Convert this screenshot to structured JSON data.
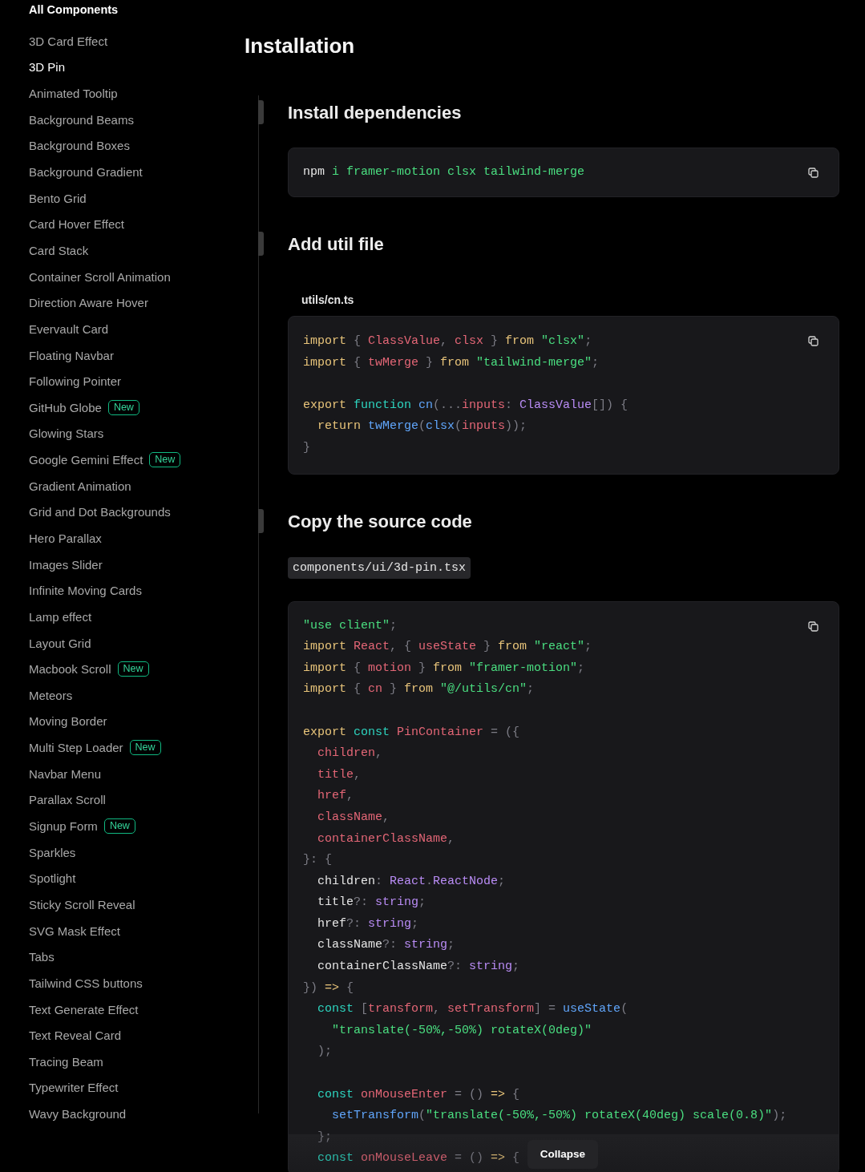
{
  "sidebar": {
    "heading": "All Components",
    "items": [
      {
        "label": "3D Card Effect",
        "selected": false
      },
      {
        "label": "3D Pin",
        "selected": true
      },
      {
        "label": "Animated Tooltip",
        "selected": false
      },
      {
        "label": "Background Beams",
        "selected": false
      },
      {
        "label": "Background Boxes",
        "selected": false
      },
      {
        "label": "Background Gradient",
        "selected": false
      },
      {
        "label": "Bento Grid",
        "selected": false
      },
      {
        "label": "Card Hover Effect",
        "selected": false
      },
      {
        "label": "Card Stack",
        "selected": false
      },
      {
        "label": "Container Scroll Animation",
        "selected": false
      },
      {
        "label": "Direction Aware Hover",
        "selected": false
      },
      {
        "label": "Evervault Card",
        "selected": false
      },
      {
        "label": "Floating Navbar",
        "selected": false
      },
      {
        "label": "Following Pointer",
        "selected": false
      },
      {
        "label": "GitHub Globe",
        "selected": false,
        "badge": "New"
      },
      {
        "label": "Glowing Stars",
        "selected": false
      },
      {
        "label": "Google Gemini Effect",
        "selected": false,
        "badge": "New"
      },
      {
        "label": "Gradient Animation",
        "selected": false
      },
      {
        "label": "Grid and Dot Backgrounds",
        "selected": false
      },
      {
        "label": "Hero Parallax",
        "selected": false
      },
      {
        "label": "Images Slider",
        "selected": false
      },
      {
        "label": "Infinite Moving Cards",
        "selected": false
      },
      {
        "label": "Lamp effect",
        "selected": false
      },
      {
        "label": "Layout Grid",
        "selected": false
      },
      {
        "label": "Macbook Scroll",
        "selected": false,
        "badge": "New"
      },
      {
        "label": "Meteors",
        "selected": false
      },
      {
        "label": "Moving Border",
        "selected": false
      },
      {
        "label": "Multi Step Loader",
        "selected": false,
        "badge": "New"
      },
      {
        "label": "Navbar Menu",
        "selected": false
      },
      {
        "label": "Parallax Scroll",
        "selected": false
      },
      {
        "label": "Signup Form",
        "selected": false,
        "badge": "New"
      },
      {
        "label": "Sparkles",
        "selected": false
      },
      {
        "label": "Spotlight",
        "selected": false
      },
      {
        "label": "Sticky Scroll Reveal",
        "selected": false
      },
      {
        "label": "SVG Mask Effect",
        "selected": false
      },
      {
        "label": "Tabs",
        "selected": false
      },
      {
        "label": "Tailwind CSS buttons",
        "selected": false
      },
      {
        "label": "Text Generate Effect",
        "selected": false
      },
      {
        "label": "Text Reveal Card",
        "selected": false
      },
      {
        "label": "Tracing Beam",
        "selected": false
      },
      {
        "label": "Typewriter Effect",
        "selected": false
      },
      {
        "label": "Wavy Background",
        "selected": false
      }
    ]
  },
  "title": "Installation",
  "steps": [
    {
      "kind": "command",
      "title": "Install dependencies",
      "lines": [
        {
          "tokens": [
            {
              "kind": "plain",
              "text": "npm"
            },
            {
              "kind": "string",
              "text": " i framer-motion clsx tailwind-merge"
            }
          ]
        }
      ]
    },
    {
      "kind": "file",
      "title": "Add util file",
      "filename": "utils/cn.ts",
      "lines": [
        {
          "tokens": [
            {
              "kind": "keyword",
              "text": "import"
            },
            {
              "kind": "punct",
              "text": " { "
            },
            {
              "kind": "variable",
              "text": "ClassValue"
            },
            {
              "kind": "punct",
              "text": ", "
            },
            {
              "kind": "variable",
              "text": "clsx"
            },
            {
              "kind": "punct",
              "text": " } "
            },
            {
              "kind": "keyword",
              "text": "from"
            },
            {
              "kind": "string",
              "text": " \"clsx\""
            },
            {
              "kind": "punct",
              "text": ";"
            }
          ]
        },
        {
          "tokens": [
            {
              "kind": "keyword",
              "text": "import"
            },
            {
              "kind": "punct",
              "text": " { "
            },
            {
              "kind": "variable",
              "text": "twMerge"
            },
            {
              "kind": "punct",
              "text": " } "
            },
            {
              "kind": "keyword",
              "text": "from"
            },
            {
              "kind": "string",
              "text": " \"tailwind-merge\""
            },
            {
              "kind": "punct",
              "text": ";"
            }
          ]
        },
        {
          "space_before": true,
          "tokens": [
            {
              "kind": "keyword",
              "text": "export"
            },
            {
              "kind": "decl",
              "text": " function"
            },
            {
              "kind": "call",
              "text": " cn"
            },
            {
              "kind": "punct",
              "text": "(..."
            },
            {
              "kind": "variable",
              "text": "inputs"
            },
            {
              "kind": "punct",
              "text": ": "
            },
            {
              "kind": "type",
              "text": "ClassValue"
            },
            {
              "kind": "punct",
              "text": "[]) {"
            }
          ]
        },
        {
          "tokens": [
            {
              "kind": "keyword",
              "text": "  return"
            },
            {
              "kind": "call",
              "text": " twMerge"
            },
            {
              "kind": "punct",
              "text": "("
            },
            {
              "kind": "call",
              "text": "clsx"
            },
            {
              "kind": "punct",
              "text": "("
            },
            {
              "kind": "variable",
              "text": "inputs"
            },
            {
              "kind": "punct",
              "text": "));"
            }
          ]
        },
        {
          "tokens": [
            {
              "kind": "punct",
              "text": "}"
            }
          ]
        }
      ]
    },
    {
      "kind": "source",
      "title": "Copy the source code",
      "filename": "components/ui/3d-pin.tsx",
      "collapse": "Collapse",
      "lines": [
        {
          "tokens": [
            {
              "kind": "string",
              "text": "\"use client\""
            },
            {
              "kind": "punct",
              "text": ";"
            }
          ]
        },
        {
          "tokens": [
            {
              "kind": "keyword",
              "text": "import"
            },
            {
              "kind": "variable",
              "text": " React"
            },
            {
              "kind": "punct",
              "text": ", { "
            },
            {
              "kind": "variable",
              "text": "useState"
            },
            {
              "kind": "punct",
              "text": " } "
            },
            {
              "kind": "keyword",
              "text": "from"
            },
            {
              "kind": "string",
              "text": " \"react\""
            },
            {
              "kind": "punct",
              "text": ";"
            }
          ]
        },
        {
          "tokens": [
            {
              "kind": "keyword",
              "text": "import"
            },
            {
              "kind": "punct",
              "text": " { "
            },
            {
              "kind": "variable",
              "text": "motion"
            },
            {
              "kind": "punct",
              "text": " } "
            },
            {
              "kind": "keyword",
              "text": "from"
            },
            {
              "kind": "string",
              "text": " \"framer-motion\""
            },
            {
              "kind": "punct",
              "text": ";"
            }
          ]
        },
        {
          "tokens": [
            {
              "kind": "keyword",
              "text": "import"
            },
            {
              "kind": "punct",
              "text": " { "
            },
            {
              "kind": "variable",
              "text": "cn"
            },
            {
              "kind": "punct",
              "text": " } "
            },
            {
              "kind": "keyword",
              "text": "from"
            },
            {
              "kind": "string",
              "text": " \"@/utils/cn\""
            },
            {
              "kind": "punct",
              "text": ";"
            }
          ]
        },
        {
          "space_before": true,
          "tokens": [
            {
              "kind": "keyword",
              "text": "export"
            },
            {
              "kind": "decl",
              "text": " const"
            },
            {
              "kind": "variable",
              "text": " PinContainer"
            },
            {
              "kind": "punct",
              "text": " = ({"
            }
          ]
        },
        {
          "tokens": [
            {
              "kind": "variable",
              "text": "  children"
            },
            {
              "kind": "punct",
              "text": ","
            }
          ]
        },
        {
          "tokens": [
            {
              "kind": "variable",
              "text": "  title"
            },
            {
              "kind": "punct",
              "text": ","
            }
          ]
        },
        {
          "tokens": [
            {
              "kind": "variable",
              "text": "  href"
            },
            {
              "kind": "punct",
              "text": ","
            }
          ]
        },
        {
          "tokens": [
            {
              "kind": "variable",
              "text": "  className"
            },
            {
              "kind": "punct",
              "text": ","
            }
          ]
        },
        {
          "tokens": [
            {
              "kind": "variable",
              "text": "  containerClassName"
            },
            {
              "kind": "punct",
              "text": ","
            }
          ]
        },
        {
          "tokens": [
            {
              "kind": "punct",
              "text": "}: {"
            }
          ]
        },
        {
          "tokens": [
            {
              "kind": "plain",
              "text": "  children"
            },
            {
              "kind": "punct",
              "text": ": "
            },
            {
              "kind": "type",
              "text": "React"
            },
            {
              "kind": "punct",
              "text": "."
            },
            {
              "kind": "type",
              "text": "ReactNode"
            },
            {
              "kind": "punct",
              "text": ";"
            }
          ]
        },
        {
          "tokens": [
            {
              "kind": "plain",
              "text": "  title"
            },
            {
              "kind": "punct",
              "text": "?: "
            },
            {
              "kind": "type",
              "text": "string"
            },
            {
              "kind": "punct",
              "text": ";"
            }
          ]
        },
        {
          "tokens": [
            {
              "kind": "plain",
              "text": "  href"
            },
            {
              "kind": "punct",
              "text": "?: "
            },
            {
              "kind": "type",
              "text": "string"
            },
            {
              "kind": "punct",
              "text": ";"
            }
          ]
        },
        {
          "tokens": [
            {
              "kind": "plain",
              "text": "  className"
            },
            {
              "kind": "punct",
              "text": "?: "
            },
            {
              "kind": "type",
              "text": "string"
            },
            {
              "kind": "punct",
              "text": ";"
            }
          ]
        },
        {
          "tokens": [
            {
              "kind": "plain",
              "text": "  containerClassName"
            },
            {
              "kind": "punct",
              "text": "?: "
            },
            {
              "kind": "type",
              "text": "string"
            },
            {
              "kind": "punct",
              "text": ";"
            }
          ]
        },
        {
          "tokens": [
            {
              "kind": "punct",
              "text": "}) "
            },
            {
              "kind": "keyword",
              "text": "=>"
            },
            {
              "kind": "punct",
              "text": " {"
            }
          ]
        },
        {
          "tokens": [
            {
              "kind": "decl",
              "text": "  const"
            },
            {
              "kind": "punct",
              "text": " ["
            },
            {
              "kind": "variable",
              "text": "transform"
            },
            {
              "kind": "punct",
              "text": ", "
            },
            {
              "kind": "variable",
              "text": "setTransform"
            },
            {
              "kind": "punct",
              "text": "] = "
            },
            {
              "kind": "call",
              "text": "useState"
            },
            {
              "kind": "punct",
              "text": "("
            }
          ]
        },
        {
          "tokens": [
            {
              "kind": "string",
              "text": "    \"translate(-50%,-50%) rotateX(0deg)\""
            }
          ]
        },
        {
          "tokens": [
            {
              "kind": "punct",
              "text": "  );"
            }
          ]
        },
        {
          "space_before": true,
          "tokens": [
            {
              "kind": "decl",
              "text": "  const"
            },
            {
              "kind": "variable",
              "text": " onMouseEnter"
            },
            {
              "kind": "punct",
              "text": " = () "
            },
            {
              "kind": "keyword",
              "text": "=>"
            },
            {
              "kind": "punct",
              "text": " {"
            }
          ]
        },
        {
          "tokens": [
            {
              "kind": "call",
              "text": "    setTransform"
            },
            {
              "kind": "punct",
              "text": "("
            },
            {
              "kind": "string",
              "text": "\"translate(-50%,-50%) rotateX(40deg) scale(0.8)\""
            },
            {
              "kind": "punct",
              "text": ");"
            }
          ]
        },
        {
          "tokens": [
            {
              "kind": "punct",
              "text": "  };"
            }
          ]
        },
        {
          "tokens": [
            {
              "kind": "decl",
              "text": "  const"
            },
            {
              "kind": "variable",
              "text": " onMouseLeave"
            },
            {
              "kind": "punct",
              "text": " = () "
            },
            {
              "kind": "keyword",
              "text": "=>"
            },
            {
              "kind": "punct",
              "text": " {"
            }
          ]
        }
      ]
    }
  ]
}
